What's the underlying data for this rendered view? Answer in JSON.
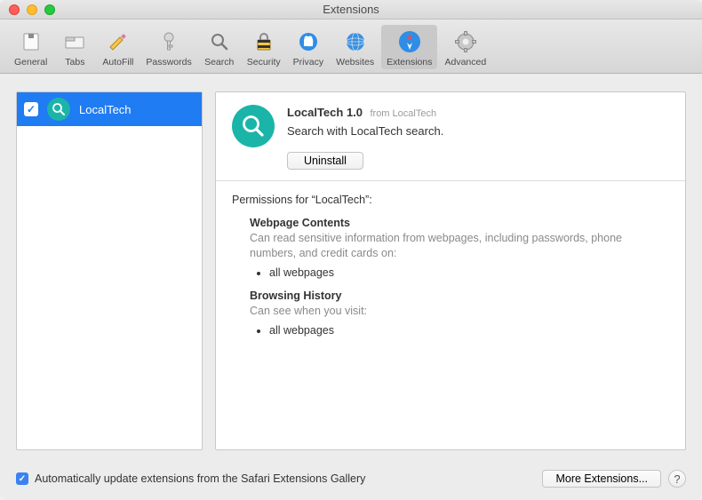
{
  "window": {
    "title": "Extensions"
  },
  "toolbar": [
    {
      "id": "general",
      "label": "General"
    },
    {
      "id": "tabs",
      "label": "Tabs"
    },
    {
      "id": "autofill",
      "label": "AutoFill"
    },
    {
      "id": "passwords",
      "label": "Passwords"
    },
    {
      "id": "search",
      "label": "Search"
    },
    {
      "id": "security",
      "label": "Security"
    },
    {
      "id": "privacy",
      "label": "Privacy"
    },
    {
      "id": "websites",
      "label": "Websites"
    },
    {
      "id": "extensions",
      "label": "Extensions",
      "selected": true
    },
    {
      "id": "advanced",
      "label": "Advanced"
    }
  ],
  "sidebar": {
    "items": [
      {
        "name": "LocalTech",
        "checked": true
      }
    ]
  },
  "detail": {
    "title": "LocalTech 1.0",
    "from": "from LocalTech",
    "description": "Search with LocalTech search.",
    "uninstall_label": "Uninstall"
  },
  "permissions": {
    "title": "Permissions for “LocalTech”:",
    "groups": [
      {
        "title": "Webpage Contents",
        "desc": "Can read sensitive information from webpages, including passwords, phone numbers, and credit cards on:",
        "items": [
          "all webpages"
        ]
      },
      {
        "title": "Browsing History",
        "desc": "Can see when you visit:",
        "items": [
          "all webpages"
        ]
      }
    ]
  },
  "footer": {
    "auto_update_label": "Automatically update extensions from the Safari Extensions Gallery",
    "auto_update_checked": true,
    "more_label": "More Extensions...",
    "help_label": "?"
  }
}
